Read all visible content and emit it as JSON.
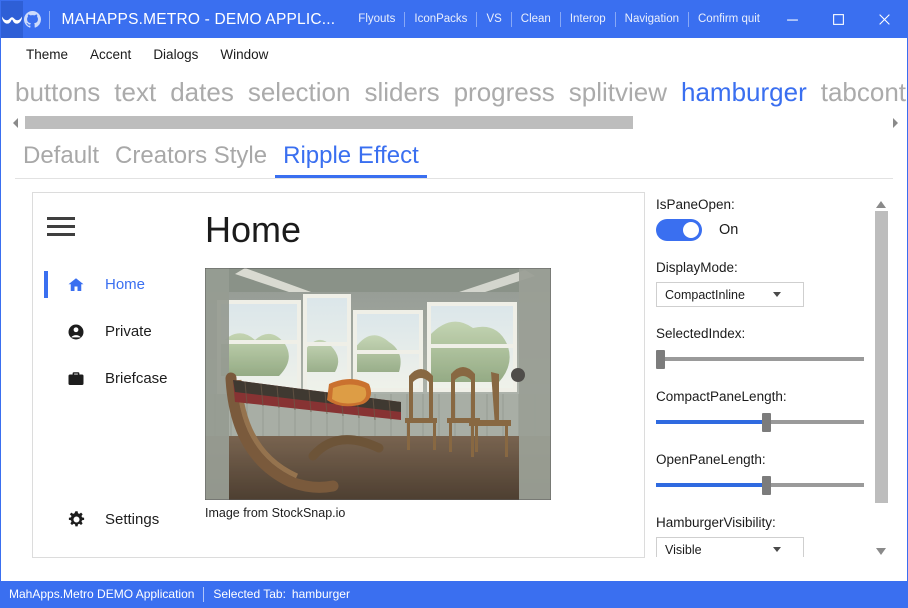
{
  "window": {
    "title": "MAHAPPS.METRO - DEMO APPLIC...",
    "logo_icon": "mahapps-mustache-icon",
    "github_icon": "github-icon",
    "titlebar_items": [
      "Flyouts",
      "IconPacks",
      "VS",
      "Clean",
      "Interop",
      "Navigation",
      "Confirm quit"
    ],
    "controls": {
      "minimize": "minimize-icon",
      "maximize": "maximize-icon",
      "close": "close-icon"
    },
    "accent_color": "#3a6ff0",
    "titlebar_logo_bg": "#2e5fd6"
  },
  "menubar": {
    "items": [
      "Theme",
      "Accent",
      "Dialogs",
      "Window"
    ]
  },
  "tabstrip": {
    "tabs": [
      "buttons",
      "text",
      "dates",
      "selection",
      "sliders",
      "progress",
      "splitview",
      "hamburger",
      "tabcont"
    ],
    "active": "hamburger",
    "scrollbar": {
      "left_arrow": "chevron-left-icon",
      "right_arrow": "chevron-right-icon",
      "thumb_left_pct": 0,
      "thumb_width_pct": 69
    }
  },
  "subtabs": {
    "tabs": [
      "Default",
      "Creators Style",
      "Ripple Effect"
    ],
    "active": "Ripple Effect"
  },
  "hamburger_demo": {
    "hamburger_icon": "hamburger-menu-icon",
    "pane_items": [
      {
        "label": "Home",
        "icon": "home-icon",
        "selected": true
      },
      {
        "label": "Private",
        "icon": "account-circle-icon",
        "selected": false
      },
      {
        "label": "Briefcase",
        "icon": "briefcase-icon",
        "selected": false
      }
    ],
    "pane_bottom_item": {
      "label": "Settings",
      "icon": "gear-icon",
      "selected": false
    },
    "content": {
      "title": "Home",
      "image_alt": "sunroom-with-hammock-photo",
      "caption": "Image from StockSnap.io"
    }
  },
  "settings_panel": {
    "is_pane_open": {
      "label": "IsPaneOpen:",
      "value": "On",
      "checked": true
    },
    "display_mode": {
      "label": "DisplayMode:",
      "value": "CompactInline",
      "arrow_icon": "chevron-down-icon"
    },
    "selected_index": {
      "label": "SelectedIndex:",
      "percent": 0
    },
    "compact_pane_length": {
      "label": "CompactPaneLength:",
      "percent": 53
    },
    "open_pane_length": {
      "label": "OpenPaneLength:",
      "percent": 53
    },
    "hamburger_visibility": {
      "label": "HamburgerVisibility:",
      "value": "Visible",
      "arrow_icon": "chevron-down-icon"
    },
    "scrollbar": {
      "up_arrow": "chevron-up-icon",
      "down_arrow": "chevron-down-icon"
    }
  },
  "statusbar": {
    "app_name": "MahApps.Metro DEMO Application",
    "selected_tab_label": "Selected Tab:",
    "selected_tab_value": "hamburger"
  }
}
